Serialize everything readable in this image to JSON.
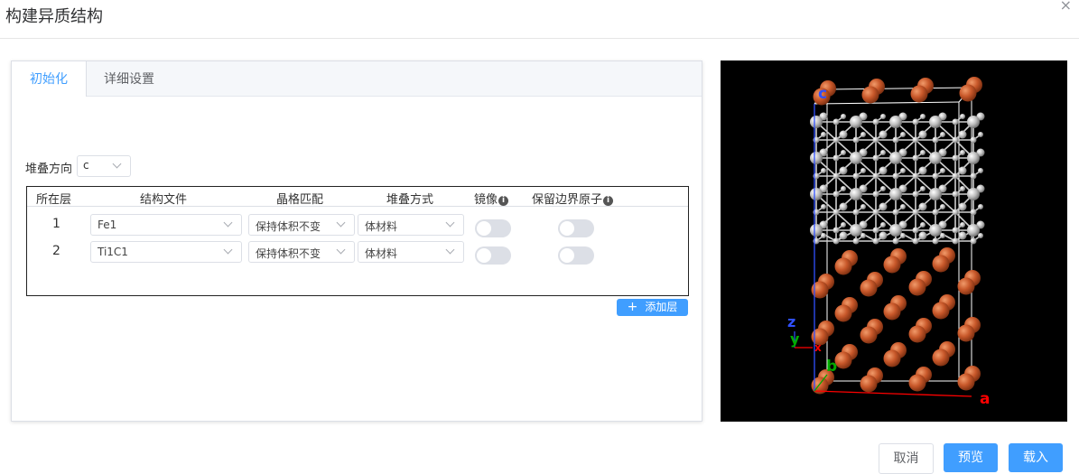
{
  "dialog": {
    "title": "构建异质结构",
    "close_icon": "×"
  },
  "tabs": [
    {
      "label": "初始化",
      "active": true
    },
    {
      "label": "详细设置",
      "active": false
    }
  ],
  "stack_direction": {
    "label": "堆叠方向",
    "value": "c"
  },
  "table": {
    "headers": [
      "所在层",
      "结构文件",
      "晶格匹配",
      "堆叠方式",
      "镜像",
      "保留边界原子"
    ],
    "rows": [
      {
        "layer": "1",
        "structure": "Fe1",
        "lattice_match": "保持体积不变",
        "stacking": "体材料",
        "mirror": false,
        "keep_boundary": false
      },
      {
        "layer": "2",
        "structure": "Ti1C1",
        "lattice_match": "保持体积不变",
        "stacking": "体材料",
        "mirror": false,
        "keep_boundary": false
      }
    ]
  },
  "add_layer": {
    "icon": "+",
    "label": "添加层"
  },
  "viewer": {
    "axis_labels": {
      "c": "c",
      "a": "a",
      "b": "b",
      "x": "x",
      "y": "y",
      "z": "z"
    },
    "colors": {
      "background": "#000000",
      "fe_atom": "#c8582a",
      "ti_c_atom": "#bfbfbf",
      "bond": "#d9d9d9",
      "axis_a": "#ff0000",
      "axis_b": "#00aa00",
      "axis_c": "#3050ff"
    }
  },
  "footer": {
    "cancel": "取消",
    "preview": "预览",
    "load": "载入"
  },
  "colors": {
    "primary": "#409eff",
    "border": "#dcdfe6"
  }
}
